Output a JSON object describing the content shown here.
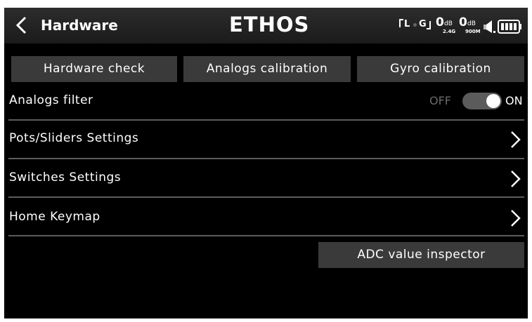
{
  "header": {
    "title": "Hardware",
    "brand": {
      "left": "ETH",
      "right": "OS"
    },
    "status": {
      "t1": "L",
      "t2": "G",
      "rssi1_value": "0",
      "rssi1_unit": "dB",
      "rssi1_band": "2.4G",
      "rssi2_value": "0",
      "rssi2_unit": "dB",
      "rssi2_band": "900M"
    }
  },
  "top_buttons": {
    "hardware_check": "Hardware check",
    "analogs_calibration": "Analogs calibration",
    "gyro_calibration": "Gyro calibration"
  },
  "rows": {
    "analogs_filter": {
      "label": "Analogs filter",
      "off_label": "OFF",
      "on_label": "ON",
      "enabled": true
    },
    "pots_sliders": {
      "label": "Pots/Sliders Settings"
    },
    "switches": {
      "label": "Switches Settings"
    },
    "home_keymap": {
      "label": "Home Keymap"
    }
  },
  "bottom_button": {
    "label": "ADC value inspector"
  },
  "icons": {
    "back": "chevron-left-icon",
    "speaker": "speaker-icon",
    "battery": "battery-icon",
    "row_chevron": "chevron-right-icon"
  }
}
